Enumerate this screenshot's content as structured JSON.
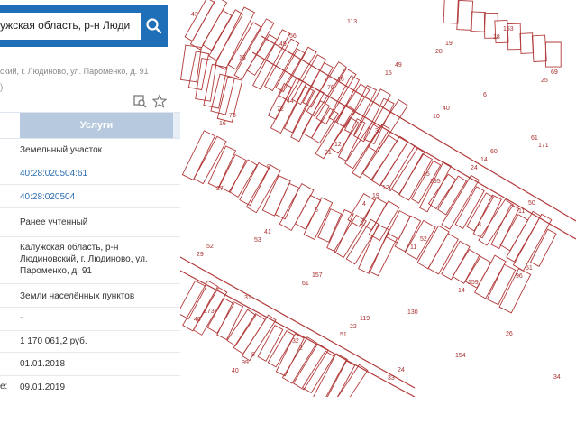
{
  "search": {
    "query": "ужская область, р-н Люди",
    "search_icon": "search-icon",
    "collapse_icon": "chevron-left-icon"
  },
  "summary": {
    "address_line": "ский, г. Людиново, ул. Пароменко, д. 91",
    "paren": ")"
  },
  "tools": {
    "icons": [
      "zoom-to-icon",
      "star-icon"
    ]
  },
  "tabs": {
    "uslugi": "Услуги"
  },
  "details": {
    "type": "Земельный участок",
    "cadastral_number": "40:28:020504:61",
    "quarter": "40:28:020504",
    "status": "Ранее учтенный",
    "address_1": "Калужская область, р-н",
    "address_2": "Людиновский, г. Людиново, ул.",
    "address_3": "Пароменко, д. 91",
    "category": "Земли населённых пунктов",
    "dash": "-",
    "cost": "1 170 061,2 руб.",
    "date_1": "01.01.2018",
    "date_2_prefix": "е:",
    "date_2": "09.01.2019"
  },
  "map": {
    "labels": [
      "43",
      "13",
      "44",
      "12",
      "12",
      "295",
      "8",
      "51",
      "173",
      "8",
      "2",
      "113",
      "49",
      "40",
      "60",
      "171",
      "27",
      "41",
      "157",
      "119",
      "130",
      "154",
      "153",
      "69",
      "73",
      "72",
      "31",
      "19",
      "52",
      "159",
      "96",
      "40",
      "99",
      "56",
      "16",
      "15",
      "10",
      "14",
      "50",
      "52",
      "53",
      "61",
      "22",
      "24",
      "19",
      "18",
      "25",
      "16",
      "9",
      "5",
      "4",
      "11",
      "14",
      "26",
      "34",
      "40",
      "49",
      "76",
      "3",
      "15",
      "24",
      "11",
      "29",
      "31",
      "32",
      "51",
      "33",
      "28",
      "6",
      "61"
    ]
  },
  "colors": {
    "accent": "#1e6fb8",
    "map_lines": "#b23a3a",
    "link": "#2a6db2"
  }
}
